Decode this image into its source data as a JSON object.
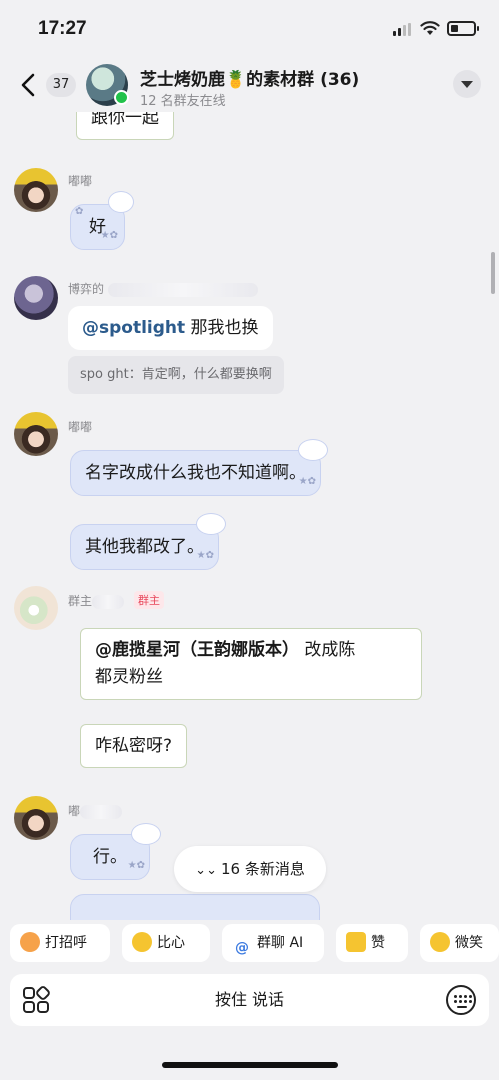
{
  "status": {
    "time": "17:27",
    "battery_level": 0.35
  },
  "header": {
    "unread_count": "37",
    "group_name": "芝士烤奶鹿🍍的素材群 (36)",
    "online_text": "12 名群友在线"
  },
  "messages": {
    "top_partial": "跟你一起",
    "m1": {
      "sender": "嘟嘟",
      "text": "好"
    },
    "m2": {
      "sender": "博弈的",
      "mention": "@spotlight",
      "text": " 那我也换",
      "quote": "spo   ght：肯定啊，什么都要换啊"
    },
    "m3": {
      "sender": "嘟嘟",
      "text1": "名字改成什么我也不知道啊。",
      "text2": "其他我都改了。"
    },
    "m4": {
      "sender": "群主",
      "role": "群主",
      "line1_mention": "@鹿揽星河（王韵娜版本）",
      "line1_rest": " 改成陈",
      "line2": "都灵粉丝",
      "text2": "咋私密呀?"
    },
    "m5": {
      "sender": "嘟",
      "text": "行。"
    }
  },
  "new_messages": "16 条新消息",
  "quick_actions": [
    "打招呼",
    "比心",
    "群聊 AI",
    "赞",
    "微笑"
  ],
  "input": {
    "hold_to_talk": "按住 说话"
  }
}
